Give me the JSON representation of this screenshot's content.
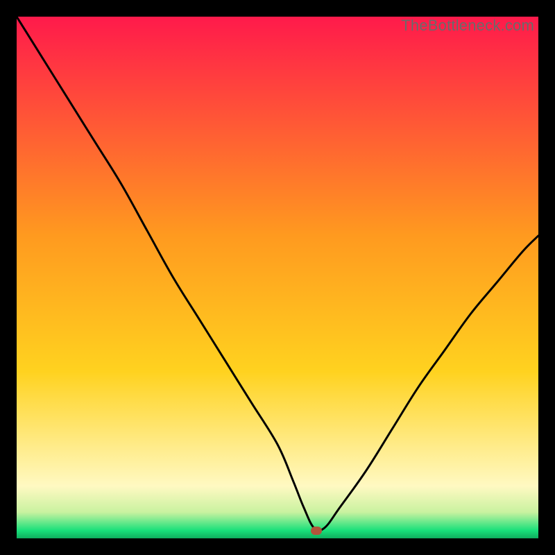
{
  "watermark": "TheBottleneck.com",
  "colors": {
    "top": "#ff1a4b",
    "mid": "#ffd21f",
    "cream": "#fff9c2",
    "green": "#18e07a",
    "border": "#000000",
    "curve": "#000000",
    "marker": "#b2543b"
  },
  "chart_data": {
    "type": "line",
    "title": "",
    "xlabel": "",
    "ylabel": "",
    "xlim": [
      0,
      100
    ],
    "ylim": [
      0,
      100
    ],
    "grid": false,
    "legend": "none",
    "marker": {
      "x": 57.5,
      "y": 1.5
    },
    "series": [
      {
        "name": "bottleneck-curve",
        "x": [
          0,
          5,
          10,
          15,
          20,
          25,
          30,
          35,
          40,
          45,
          50,
          53,
          55,
          57,
          59,
          62,
          67,
          72,
          77,
          82,
          87,
          92,
          97,
          100
        ],
        "y": [
          100,
          92,
          84,
          76,
          68,
          59,
          50,
          42,
          34,
          26,
          18,
          11,
          6,
          2,
          2,
          6,
          13,
          21,
          29,
          36,
          43,
          49,
          55,
          58
        ]
      }
    ]
  }
}
